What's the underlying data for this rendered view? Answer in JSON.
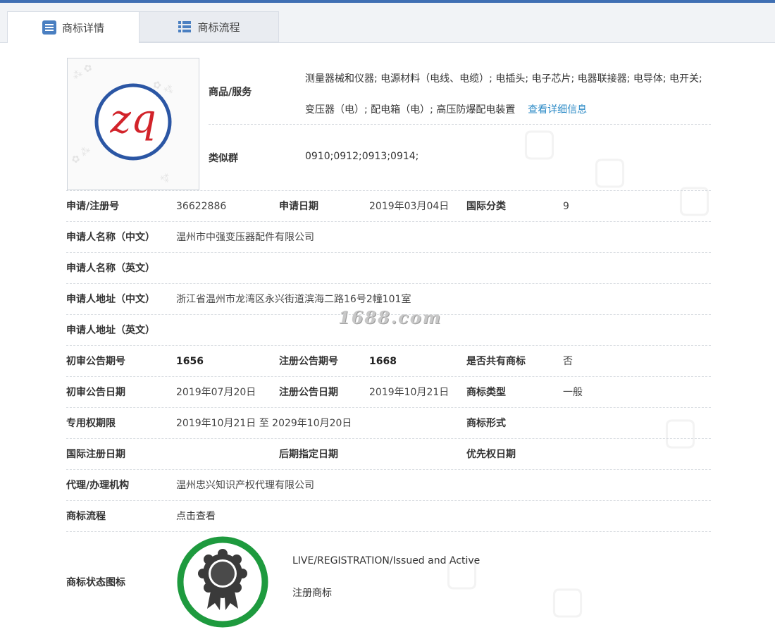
{
  "tabs": {
    "detail": "商标详情",
    "process": "商标流程"
  },
  "goods": {
    "label": "商品/服务",
    "text": "测量器械和仪器; 电源材料（电线、电缆）; 电插头; 电子芯片; 电器联接器; 电导体; 电开关; 变压器（电）; 配电箱（电）; 高压防爆配电装置",
    "detail_link": "查看详细信息"
  },
  "similar": {
    "label": "类似群",
    "value": "0910;0912;0913;0914;"
  },
  "logo_text": "zq",
  "fields": {
    "reg_no_label": "申请/注册号",
    "reg_no": "36622886",
    "app_date_label": "申请日期",
    "app_date": "2019年03月04日",
    "intl_class_label": "国际分类",
    "intl_class": "9",
    "applicant_cn_label": "申请人名称（中文）",
    "applicant_cn": "温州市中强变压器配件有限公司",
    "applicant_en_label": "申请人名称（英文）",
    "applicant_en": "",
    "address_cn_label": "申请人地址（中文）",
    "address_cn": "浙江省温州市龙湾区永兴街道滨海二路16号2幢101室",
    "address_en_label": "申请人地址（英文）",
    "address_en": "",
    "prelim_no_label": "初审公告期号",
    "prelim_no": "1656",
    "reg_pub_no_label": "注册公告期号",
    "reg_pub_no": "1668",
    "shared_label": "是否共有商标",
    "shared": "否",
    "prelim_date_label": "初审公告日期",
    "prelim_date": "2019年07月20日",
    "reg_pub_date_label": "注册公告日期",
    "reg_pub_date": "2019年10月21日",
    "tm_type_label": "商标类型",
    "tm_type": "一般",
    "term_label": "专用权期限",
    "term": "2019年10月21日 至 2029年10月20日",
    "tm_form_label": "商标形式",
    "tm_form": "",
    "intl_reg_date_label": "国际注册日期",
    "later_designation_label": "后期指定日期",
    "priority_date_label": "优先权日期",
    "agent_label": "代理/办理机构",
    "agent": "温州忠兴知识产权代理有限公司",
    "flow_label": "商标流程",
    "flow_link": "点击查看"
  },
  "status": {
    "label": "商标状态图标",
    "english": "LIVE/REGISTRATION/Issued and Active",
    "chinese": "注册商标"
  },
  "watermark": "1688.com",
  "colors": {
    "accent": "#3f6fb3",
    "link": "#2b8ac6",
    "status_ring": "#1e9a3e"
  }
}
